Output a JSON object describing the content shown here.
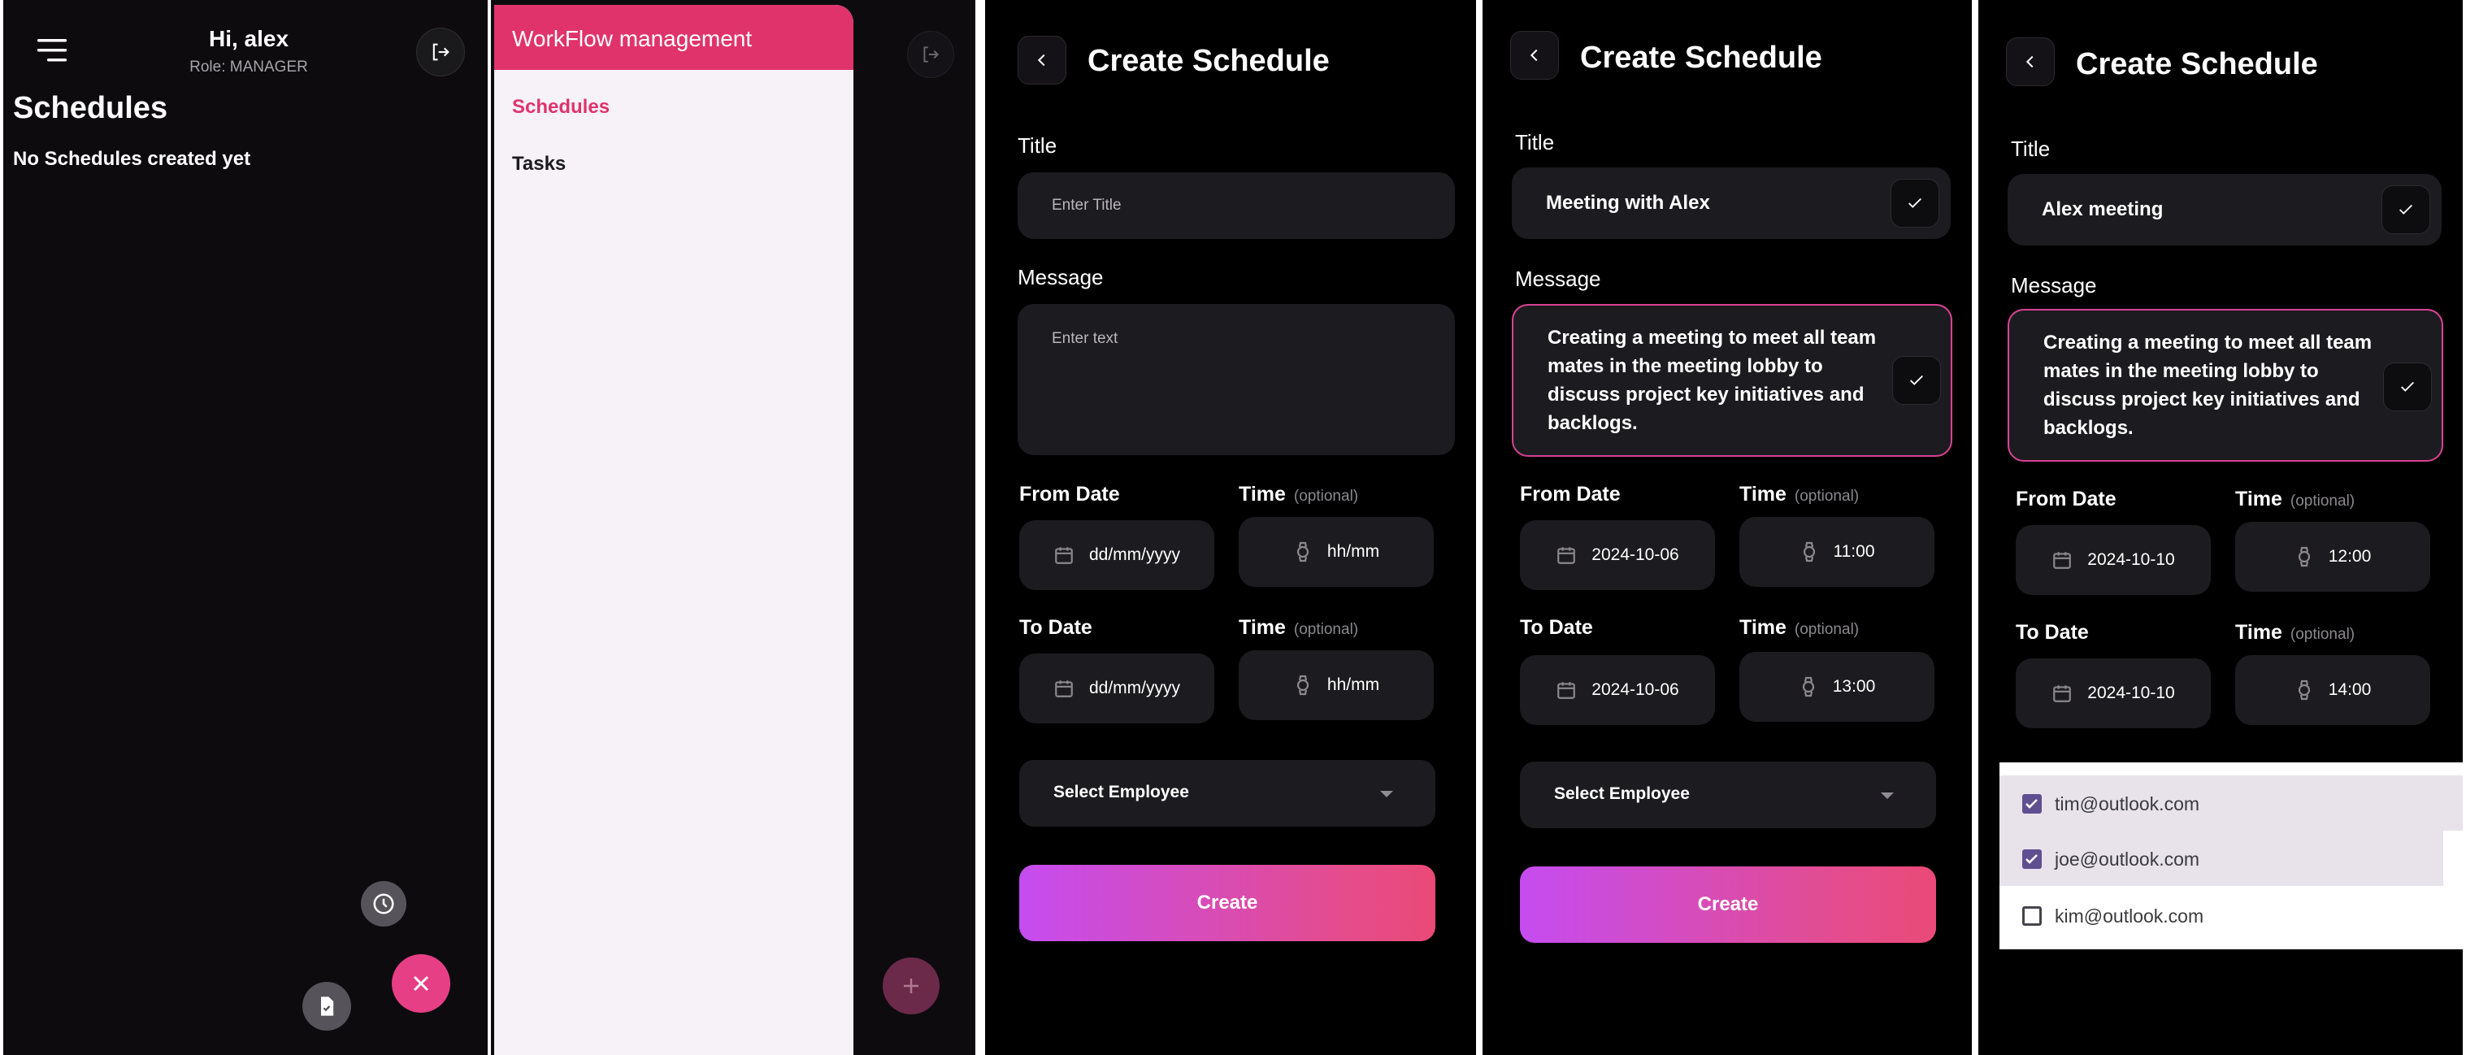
{
  "home": {
    "greeting": "Hi, alex",
    "role": "Role: MANAGER",
    "title": "Schedules",
    "empty_message": "No Schedules created yet",
    "menu_icon": "hamburger-menu-icon",
    "logout_icon": "logout-icon",
    "fab_icons": [
      "clock-icon",
      "document-check-icon",
      "close-icon"
    ],
    "fab_color": "#e63f86"
  },
  "drawer": {
    "header": "WorkFlow management",
    "items": [
      {
        "label": "Schedules",
        "active": true
      },
      {
        "label": "Tasks",
        "active": false
      }
    ],
    "header_color": "#e0336c",
    "fab_icon": "plus-icon"
  },
  "forms": [
    {
      "title": "Create Schedule",
      "title_label": "Title",
      "title_placeholder": "Enter Title",
      "title_value": "",
      "message_label": "Message",
      "message_placeholder": "Enter text",
      "message_value": "",
      "from_date_label": "From Date",
      "from_date": "dd/mm/yyyy",
      "time_label": "Time",
      "optional": "(optional)",
      "from_time": "hh/mm",
      "to_date_label": "To Date",
      "to_date": "dd/mm/yyyy",
      "to_time": "hh/mm",
      "select_label": "Select Employee",
      "create_label": "Create"
    },
    {
      "title": "Create Schedule",
      "title_label": "Title",
      "title_value": "Meeting with Alex",
      "message_label": "Message",
      "message_value": "Creating a meeting to meet all team mates in the meeting lobby to discuss project key initiatives and backlogs.",
      "from_date_label": "From Date",
      "from_date": "2024-10-06",
      "time_label": "Time",
      "optional": "(optional)",
      "from_time": "11:00",
      "to_date_label": "To Date",
      "to_date": "2024-10-06",
      "to_time": "13:00",
      "select_label": "Select Employee",
      "create_label": "Create"
    },
    {
      "title": "Create Schedule",
      "title_label": "Title",
      "title_value": "Alex meeting",
      "message_label": "Message",
      "message_value": "Creating a meeting to meet all team mates in the meeting lobby to discuss project key initiatives and backlogs.",
      "from_date_label": "From Date",
      "from_date": "2024-10-10",
      "time_label": "Time",
      "optional": "(optional)",
      "from_time": "12:00",
      "to_date_label": "To Date",
      "to_date": "2024-10-10",
      "to_time": "14:00"
    }
  ],
  "employee_menu": [
    {
      "email": "tim@outlook.com",
      "checked": true
    },
    {
      "email": "joe@outlook.com",
      "checked": true
    },
    {
      "email": "kim@outlook.com",
      "checked": false
    }
  ],
  "colors": {
    "background": "#000000",
    "field": "#1c1b1f",
    "accent_pink": "#d84394",
    "gradient_start": "#c54cf0",
    "gradient_end": "#ea4a78",
    "checkbox": "#5f4f91"
  }
}
